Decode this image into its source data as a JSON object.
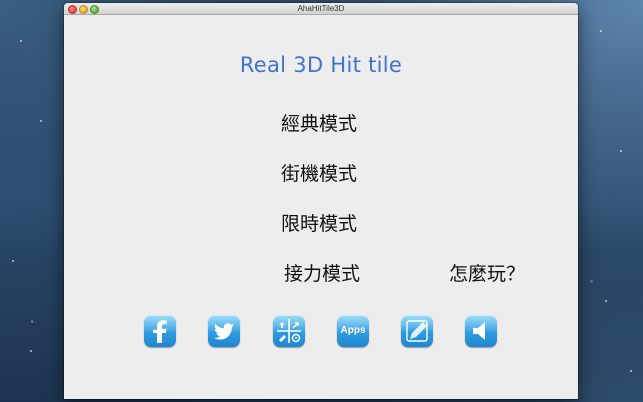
{
  "window": {
    "title": "AhaHitTile3D"
  },
  "game": {
    "title": "Real 3D Hit tile",
    "title_color": "#3e73cf"
  },
  "menu": {
    "classic": "經典模式",
    "arcade": "街機模式",
    "timed": "限時模式",
    "relay": "接力模式",
    "how_to_play": "怎麼玩？"
  },
  "share_buttons": {
    "icons": [
      "facebook-icon",
      "twitter-icon",
      "tools-icon",
      "apps-icon",
      "pencil-icon",
      "speaker-icon"
    ],
    "apps_label": "Apps",
    "accent_color": "#2e9be0"
  }
}
